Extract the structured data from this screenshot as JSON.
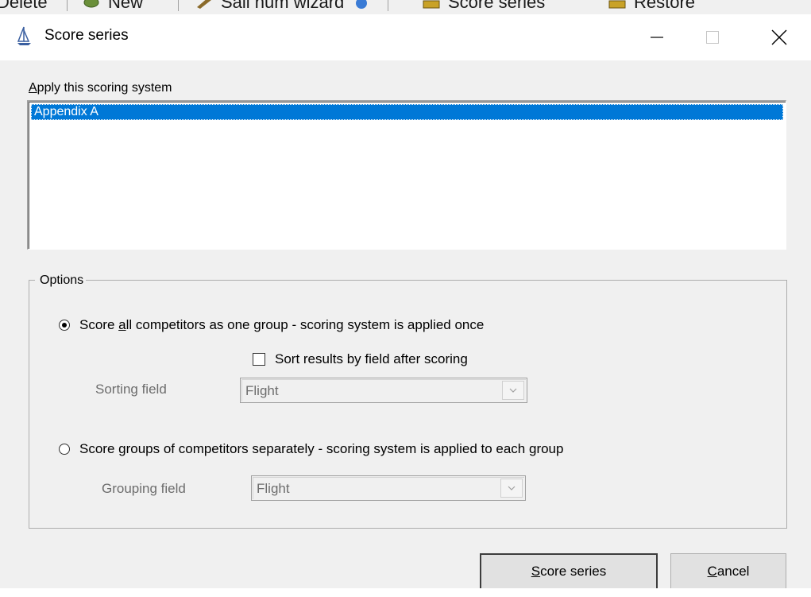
{
  "background_toolbar": {
    "items": [
      {
        "label": "Delete",
        "icon": "delete-icon"
      },
      {
        "label": "New",
        "icon": "new-icon"
      },
      {
        "label": "Sail num wizard",
        "icon": "wizard-icon"
      },
      {
        "label": "",
        "icon": "globe-icon"
      },
      {
        "label": "Score series",
        "icon": "score-series-icon"
      },
      {
        "label": "Restore",
        "icon": "restore-icon"
      }
    ]
  },
  "dialog": {
    "title": "Score series",
    "app_icon": "yacht-icon",
    "controls": {
      "minimize": "minimize-icon",
      "maximize": "maximize-icon",
      "close": "close-icon"
    }
  },
  "scoring": {
    "label_accel": "A",
    "label_rest": "pply this scoring system",
    "systems": [
      "Appendix A"
    ],
    "selected_index": 0
  },
  "options": {
    "legend": "Options",
    "one_group": {
      "label_before": "Score ",
      "label_accel": "a",
      "label_after": "ll competitors as one group  -  scoring system is applied once",
      "selected": true
    },
    "sort_checkbox": {
      "label": "Sort results by field after scoring",
      "checked": false
    },
    "sorting_field": {
      "label": "Sorting field",
      "value": "Flight"
    },
    "separate_groups": {
      "label": "Score groups of competitors separately  -  scoring system is applied to each group",
      "selected": false
    },
    "grouping_field": {
      "label": "Grouping field",
      "value": "Flight"
    }
  },
  "buttons": {
    "score": {
      "accel": "S",
      "rest": "core series"
    },
    "cancel": {
      "accel": "C",
      "rest": "ancel"
    }
  },
  "colors": {
    "selection": "#0078d7",
    "dialog_bg": "#f0f0f0",
    "disabled_text": "#6d6d6d"
  }
}
